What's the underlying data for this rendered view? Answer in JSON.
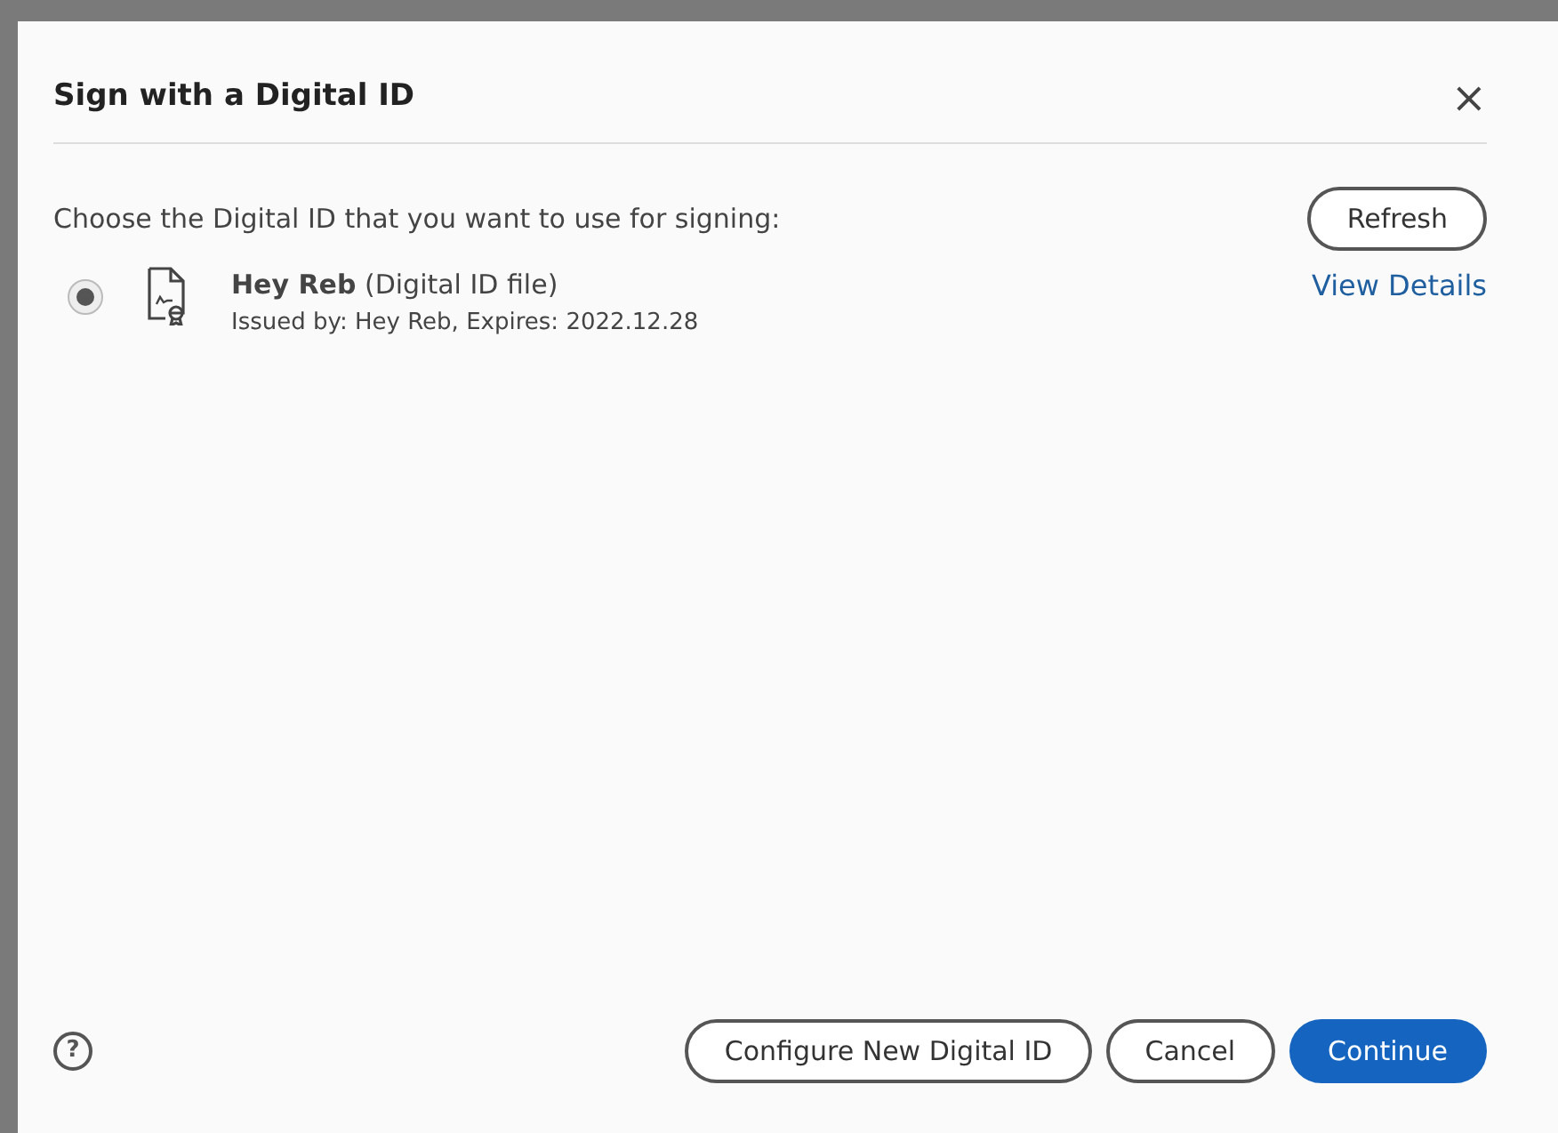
{
  "dialog": {
    "title": "Sign with a Digital ID",
    "close": "×"
  },
  "prompt": "Choose the Digital ID that you want to use for signing:",
  "refresh_button": "Refresh",
  "ids": [
    {
      "name": "**Hey Reb** (Digital ID file)",
      "details": "Issued by: Hey Reb, Expires: 2022.12.28",
      "link": "View Details",
      "selected": true
    }
  ],
  "footer": {
    "help": "?",
    "buttons": [
      {
        "label": "Configure New Digital ID",
        "kind": "outline"
      },
      {
        "label": "Cancel",
        "kind": "outline"
      },
      {
        "label": "Continue",
        "kind": "primary"
      }
    ]
  }
}
